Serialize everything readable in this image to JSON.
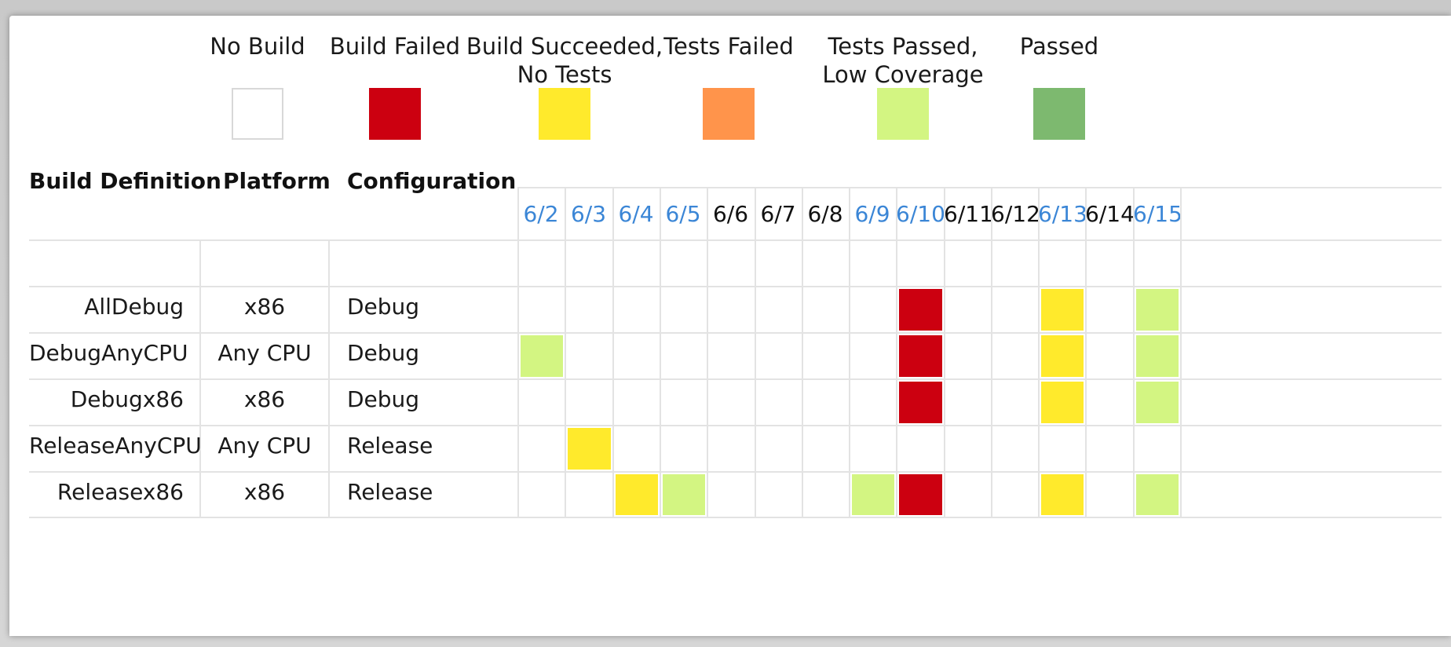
{
  "legend": [
    {
      "label_lines": [
        "No Build"
      ],
      "color": "#ffffff"
    },
    {
      "label_lines": [
        "Build Failed"
      ],
      "color": "#cc0010"
    },
    {
      "label_lines": [
        "Build Succeeded,",
        "No Tests"
      ],
      "color": "#ffea2c"
    },
    {
      "label_lines": [
        "Tests Failed"
      ],
      "color": "#ff944b"
    },
    {
      "label_lines": [
        "Tests Passed,",
        "Low Coverage"
      ],
      "color": "#d3f582"
    },
    {
      "label_lines": [
        "Passed"
      ],
      "color": "#7db96f"
    }
  ],
  "headers": {
    "build_definition": "Build Definition",
    "platform": "Platform",
    "configuration": "Configuration"
  },
  "dates": [
    {
      "label": "6/2",
      "link": true
    },
    {
      "label": "6/3",
      "link": true
    },
    {
      "label": "6/4",
      "link": true
    },
    {
      "label": "6/5",
      "link": true
    },
    {
      "label": "6/6",
      "link": false
    },
    {
      "label": "6/7",
      "link": false
    },
    {
      "label": "6/8",
      "link": false
    },
    {
      "label": "6/9",
      "link": true
    },
    {
      "label": "6/10",
      "link": true
    },
    {
      "label": "6/11",
      "link": false
    },
    {
      "label": "6/12",
      "link": false
    },
    {
      "label": "6/13",
      "link": true
    },
    {
      "label": "6/14",
      "link": false
    },
    {
      "label": "6/15",
      "link": true
    }
  ],
  "rows": [
    {
      "definition": "AllDebug",
      "platform": "x86",
      "configuration": "Debug",
      "statuses": [
        "none",
        "none",
        "none",
        "none",
        "none",
        "none",
        "none",
        "none",
        "failed",
        "none",
        "none",
        "no_tests",
        "none",
        "low_coverage"
      ]
    },
    {
      "definition": "DebugAnyCPU",
      "platform": "Any CPU",
      "configuration": "Debug",
      "statuses": [
        "low_coverage",
        "none",
        "none",
        "none",
        "none",
        "none",
        "none",
        "none",
        "failed",
        "none",
        "none",
        "no_tests",
        "none",
        "low_coverage"
      ]
    },
    {
      "definition": "Debugx86",
      "platform": "x86",
      "configuration": "Debug",
      "statuses": [
        "none",
        "none",
        "none",
        "none",
        "none",
        "none",
        "none",
        "none",
        "failed",
        "none",
        "none",
        "no_tests",
        "none",
        "low_coverage"
      ]
    },
    {
      "definition": "ReleaseAnyCPU",
      "platform": "Any CPU",
      "configuration": "Release",
      "statuses": [
        "none",
        "no_tests",
        "none",
        "none",
        "none",
        "none",
        "none",
        "none",
        "none",
        "none",
        "none",
        "none",
        "none",
        "none"
      ]
    },
    {
      "definition": "Releasex86",
      "platform": "x86",
      "configuration": "Release",
      "statuses": [
        "none",
        "none",
        "no_tests",
        "low_coverage",
        "none",
        "none",
        "none",
        "low_coverage",
        "failed",
        "none",
        "none",
        "no_tests",
        "none",
        "low_coverage"
      ]
    }
  ],
  "status_colors": {
    "none": "#ffffff",
    "failed": "#cc0010",
    "no_tests": "#ffea2c",
    "tests_failed": "#ff944b",
    "low_coverage": "#d3f582",
    "passed": "#7db96f"
  }
}
